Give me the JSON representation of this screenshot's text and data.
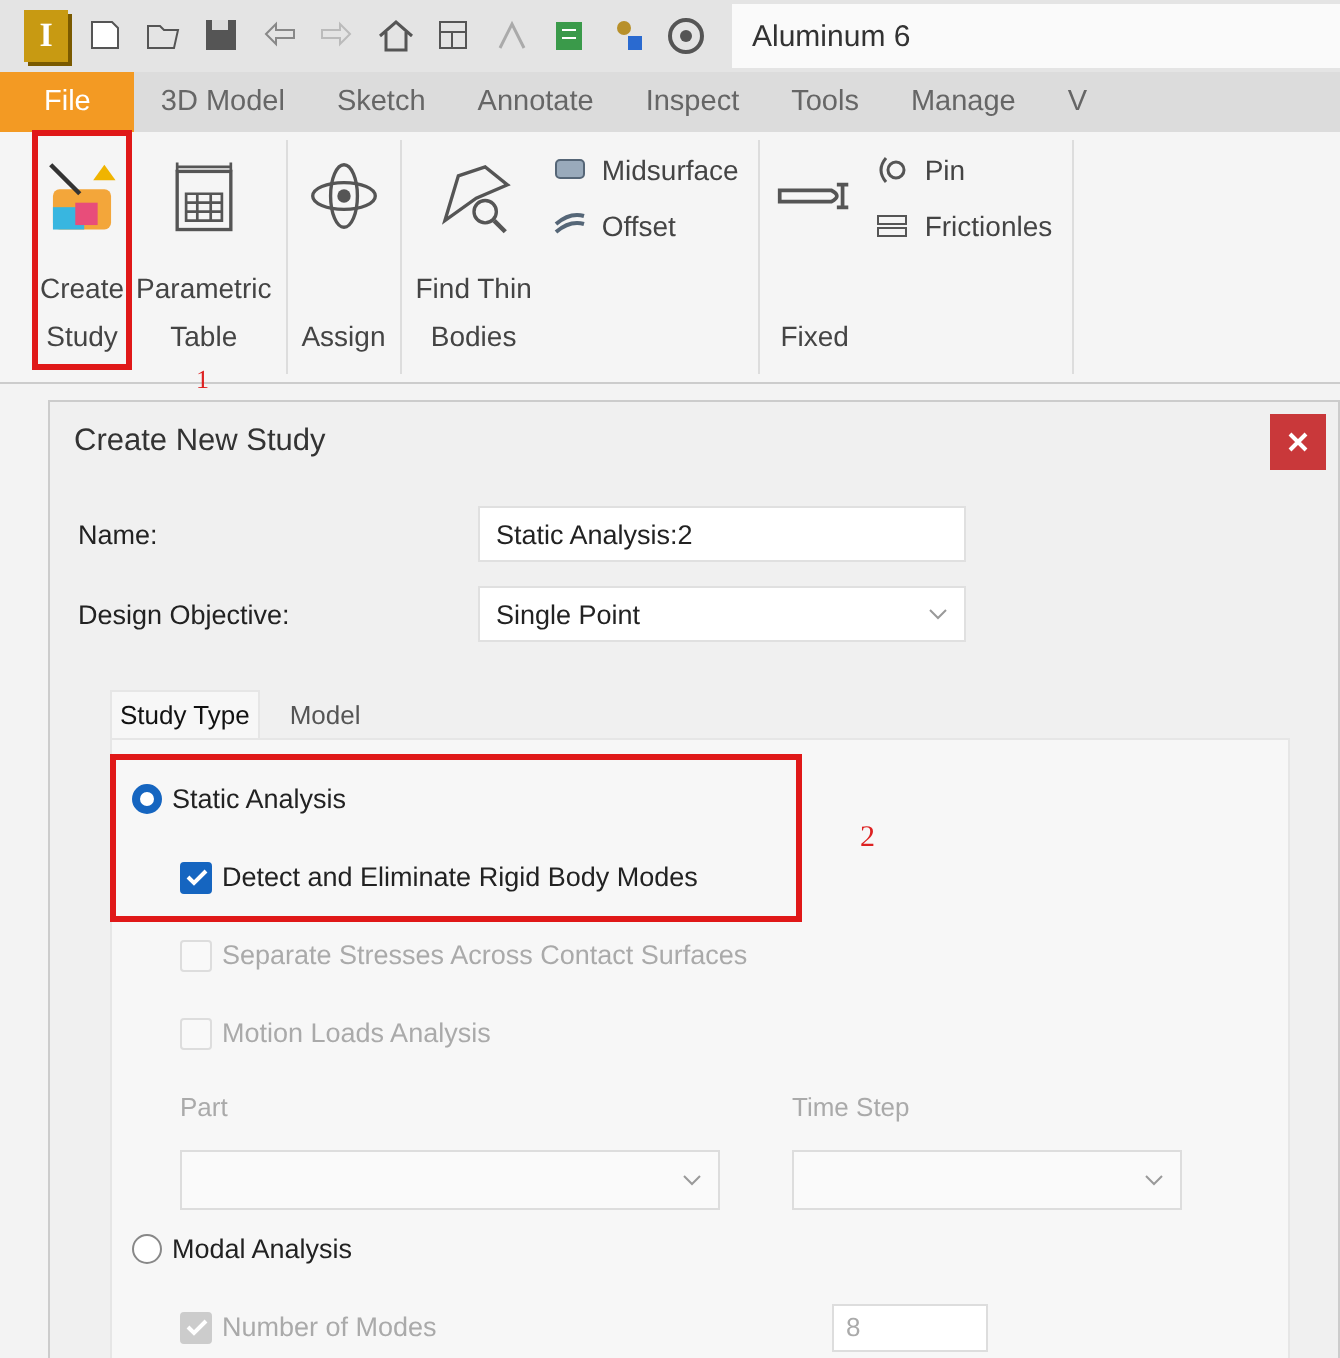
{
  "quick_access": {
    "logo": "I",
    "document_title": "Aluminum 6"
  },
  "menu_tabs": [
    {
      "label": "File",
      "selected": true
    },
    {
      "label": "3D Model",
      "selected": false
    },
    {
      "label": "Sketch",
      "selected": false
    },
    {
      "label": "Annotate",
      "selected": false
    },
    {
      "label": "Inspect",
      "selected": false
    },
    {
      "label": "Tools",
      "selected": false
    },
    {
      "label": "Manage",
      "selected": false
    },
    {
      "label": "V",
      "selected": false
    }
  ],
  "ribbon": [
    {
      "kind": "large",
      "label": "Create\nStudy",
      "marked": true
    },
    {
      "kind": "large",
      "label": "Parametric\nTable",
      "marked": false
    },
    {
      "kind": "large",
      "label": "Assign",
      "marked": false
    },
    {
      "kind": "large",
      "label": "Find Thin\nBodies",
      "marked": false
    },
    {
      "kind": "small",
      "items": [
        {
          "label": "Midsurface"
        },
        {
          "label": "Offset"
        }
      ]
    },
    {
      "kind": "large",
      "label": "Fixed",
      "marked": false
    },
    {
      "kind": "small",
      "items": [
        {
          "label": "Pin"
        },
        {
          "label": "Frictionles"
        }
      ]
    }
  ],
  "annotations": [
    {
      "label": "1"
    },
    {
      "label": "2"
    }
  ],
  "dialog": {
    "title": "Create New Study",
    "fields": [
      {
        "kind": "text",
        "label": "Name:",
        "value": "Static Analysis:2"
      },
      {
        "kind": "select",
        "label": "Design Objective:",
        "value": "Single Point"
      }
    ],
    "tabs": [
      {
        "label": "Study Type",
        "selected": true
      },
      {
        "label": "Model",
        "selected": false
      }
    ],
    "options": [
      {
        "kind": "radio",
        "label": "Static Analysis",
        "selected": true,
        "marked": true
      },
      {
        "kind": "checkbox",
        "label": "Detect and Eliminate Rigid Body Modes",
        "checked": true,
        "disabled": false,
        "marked": true
      },
      {
        "kind": "checkbox",
        "label": "Separate Stresses Across Contact Surfaces",
        "checked": false,
        "disabled": true
      },
      {
        "kind": "checkbox",
        "label": "Motion Loads Analysis",
        "checked": false,
        "disabled": true
      },
      {
        "kind": "selects",
        "items": [
          {
            "label": "Part",
            "disabled": true
          },
          {
            "label": "Time Step",
            "disabled": true
          }
        ]
      },
      {
        "kind": "radio",
        "label": "Modal Analysis",
        "selected": false,
        "marked": false
      },
      {
        "kind": "checkbox",
        "label": "Number of Modes",
        "checked": true,
        "disabled": true,
        "value": "8"
      }
    ]
  }
}
